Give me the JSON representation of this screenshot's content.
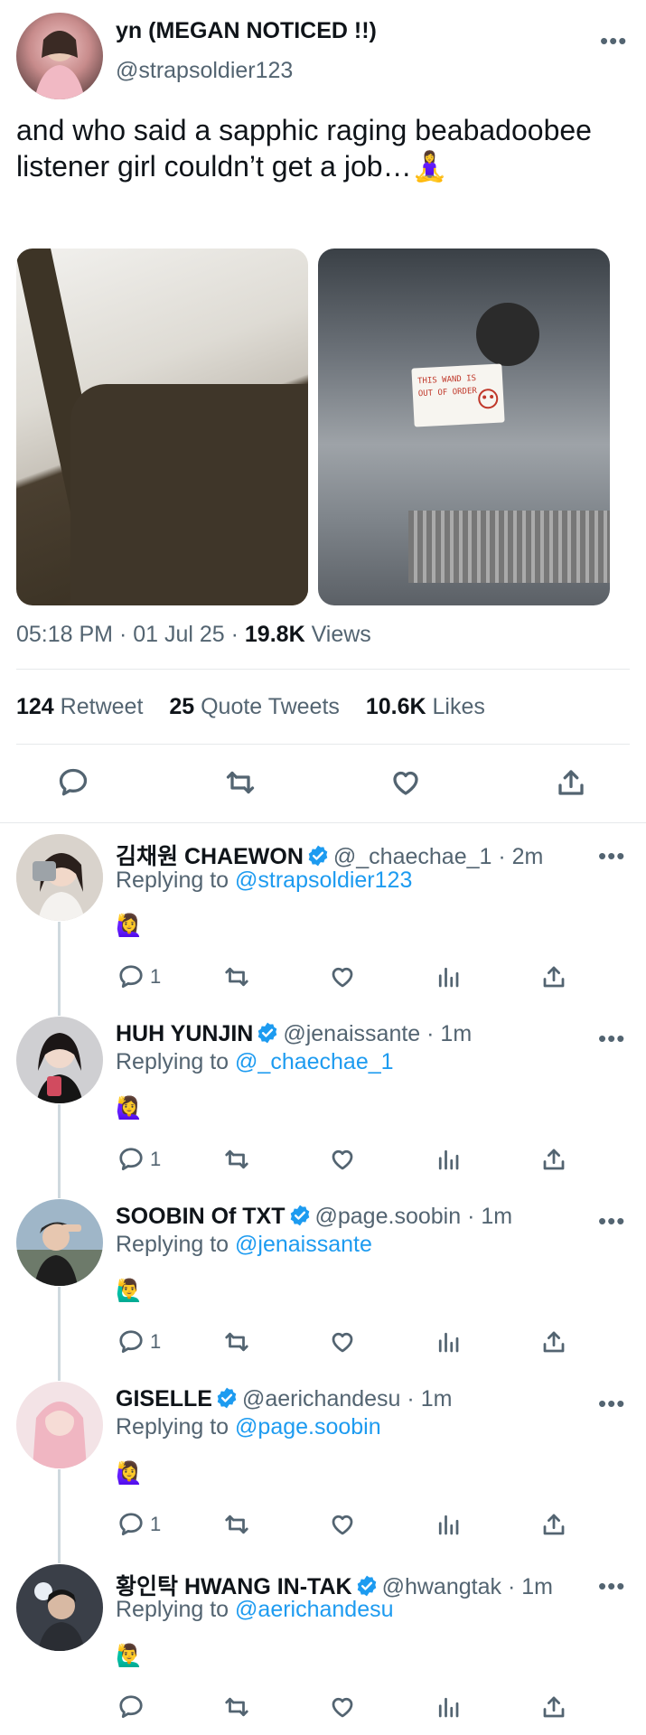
{
  "tweet": {
    "author_name": "yn (MEGAN NOTICED !!)",
    "author_handle": "@strapsoldier123",
    "text": "and who said a sapphic raging beabadoobee listener girl couldn’t get a job…🧘‍♀️",
    "photo_2_note": "THIS WAND IS OUT OF ORDER",
    "time": "05:18 PM · 01 Jul 25 · ",
    "views_count": "19.8K",
    "views_label": " Views",
    "stats": {
      "retweets_count": "124",
      "retweets_label": "Retweet",
      "quotes_count": "25",
      "quotes_label": "Quote Tweets",
      "likes_count": "10.6K",
      "likes_label": "Likes"
    },
    "more_icon": "more-dots-icon",
    "action_icons": [
      "reply-icon",
      "retweet-icon",
      "like-icon",
      "share-icon"
    ]
  },
  "replies": [
    {
      "name": "김채원 CHAEWON",
      "handle": "@_chaechae_1",
      "time": "· 2m",
      "replying_prefix": "Replying to ",
      "replying_to": "@strapsoldier123",
      "emoji": "🙋‍♀️",
      "reply_count": "1"
    },
    {
      "name": "HUH YUNJIN",
      "handle": "@jenaissante",
      "time": "· 1m",
      "replying_prefix": "Replying to ",
      "replying_to": "@_chaechae_1",
      "emoji": "🙋‍♀️",
      "reply_count": "1"
    },
    {
      "name": "SOOBIN Of TXT",
      "handle": "@page.soobin",
      "time": "· 1m",
      "replying_prefix": "Replying to ",
      "replying_to": "@jenaissante",
      "emoji": "🙋‍♂️",
      "reply_count": "1"
    },
    {
      "name": "GISELLE",
      "handle": "@aerichandesu",
      "time": "· 1m",
      "replying_prefix": "Replying to ",
      "replying_to": "@page.soobin",
      "emoji": "🙋‍♀️",
      "reply_count": "1"
    },
    {
      "name": "황인탁 HWANG IN-TAK",
      "handle": "@hwangtak",
      "time": "· 1m",
      "replying_prefix": "Replying to ",
      "replying_to": "@aerichandesu",
      "emoji": "🙋‍♂️",
      "reply_count": ""
    }
  ],
  "colors": {
    "link": "#1d9bf0",
    "muted": "#536471",
    "text": "#0f1419",
    "verified": "#1d9bf0"
  }
}
